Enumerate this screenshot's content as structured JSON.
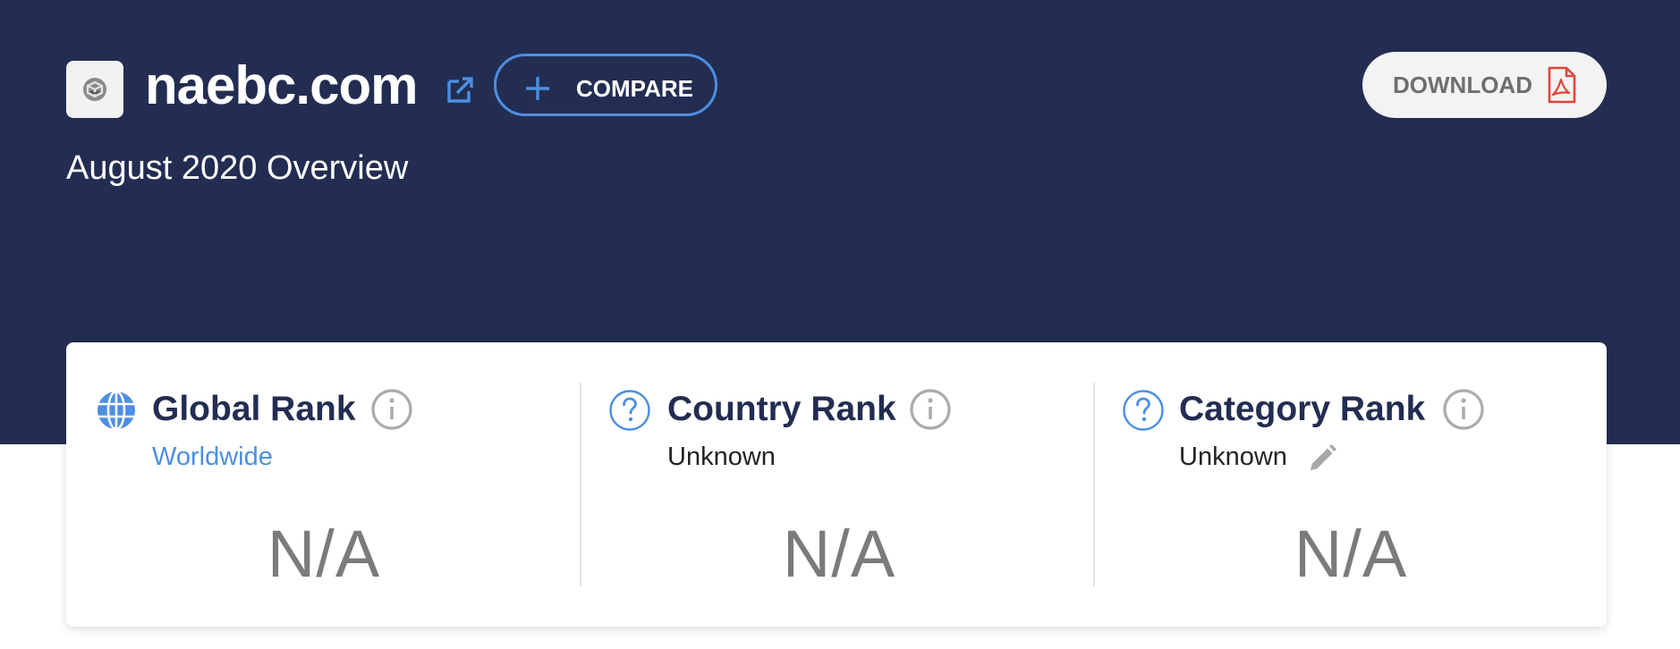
{
  "site": {
    "domain": "naebc.com",
    "subtitle": "August 2020 Overview",
    "favicon_icon": "site-favicon-icon",
    "external_link_icon": "external-link-icon"
  },
  "buttons": {
    "compare_label": "COMPARE",
    "download_label": "DOWNLOAD",
    "compare_icon": "plus-icon",
    "download_icon": "pdf-file-icon"
  },
  "ranks": [
    {
      "title": "Global Rank",
      "subtitle": "Worldwide",
      "value": "N/A",
      "icon": "globe-icon"
    },
    {
      "title": "Country Rank",
      "subtitle": "Unknown",
      "value": "N/A",
      "icon": "question-circle-icon"
    },
    {
      "title": "Category Rank",
      "subtitle": "Unknown",
      "value": "N/A",
      "icon": "question-circle-icon"
    }
  ],
  "colors": {
    "hero_background": "#232d52",
    "accent_blue": "#4d8fe0",
    "pdf_red": "#e0453a",
    "value_gray": "#7b7b7b"
  }
}
